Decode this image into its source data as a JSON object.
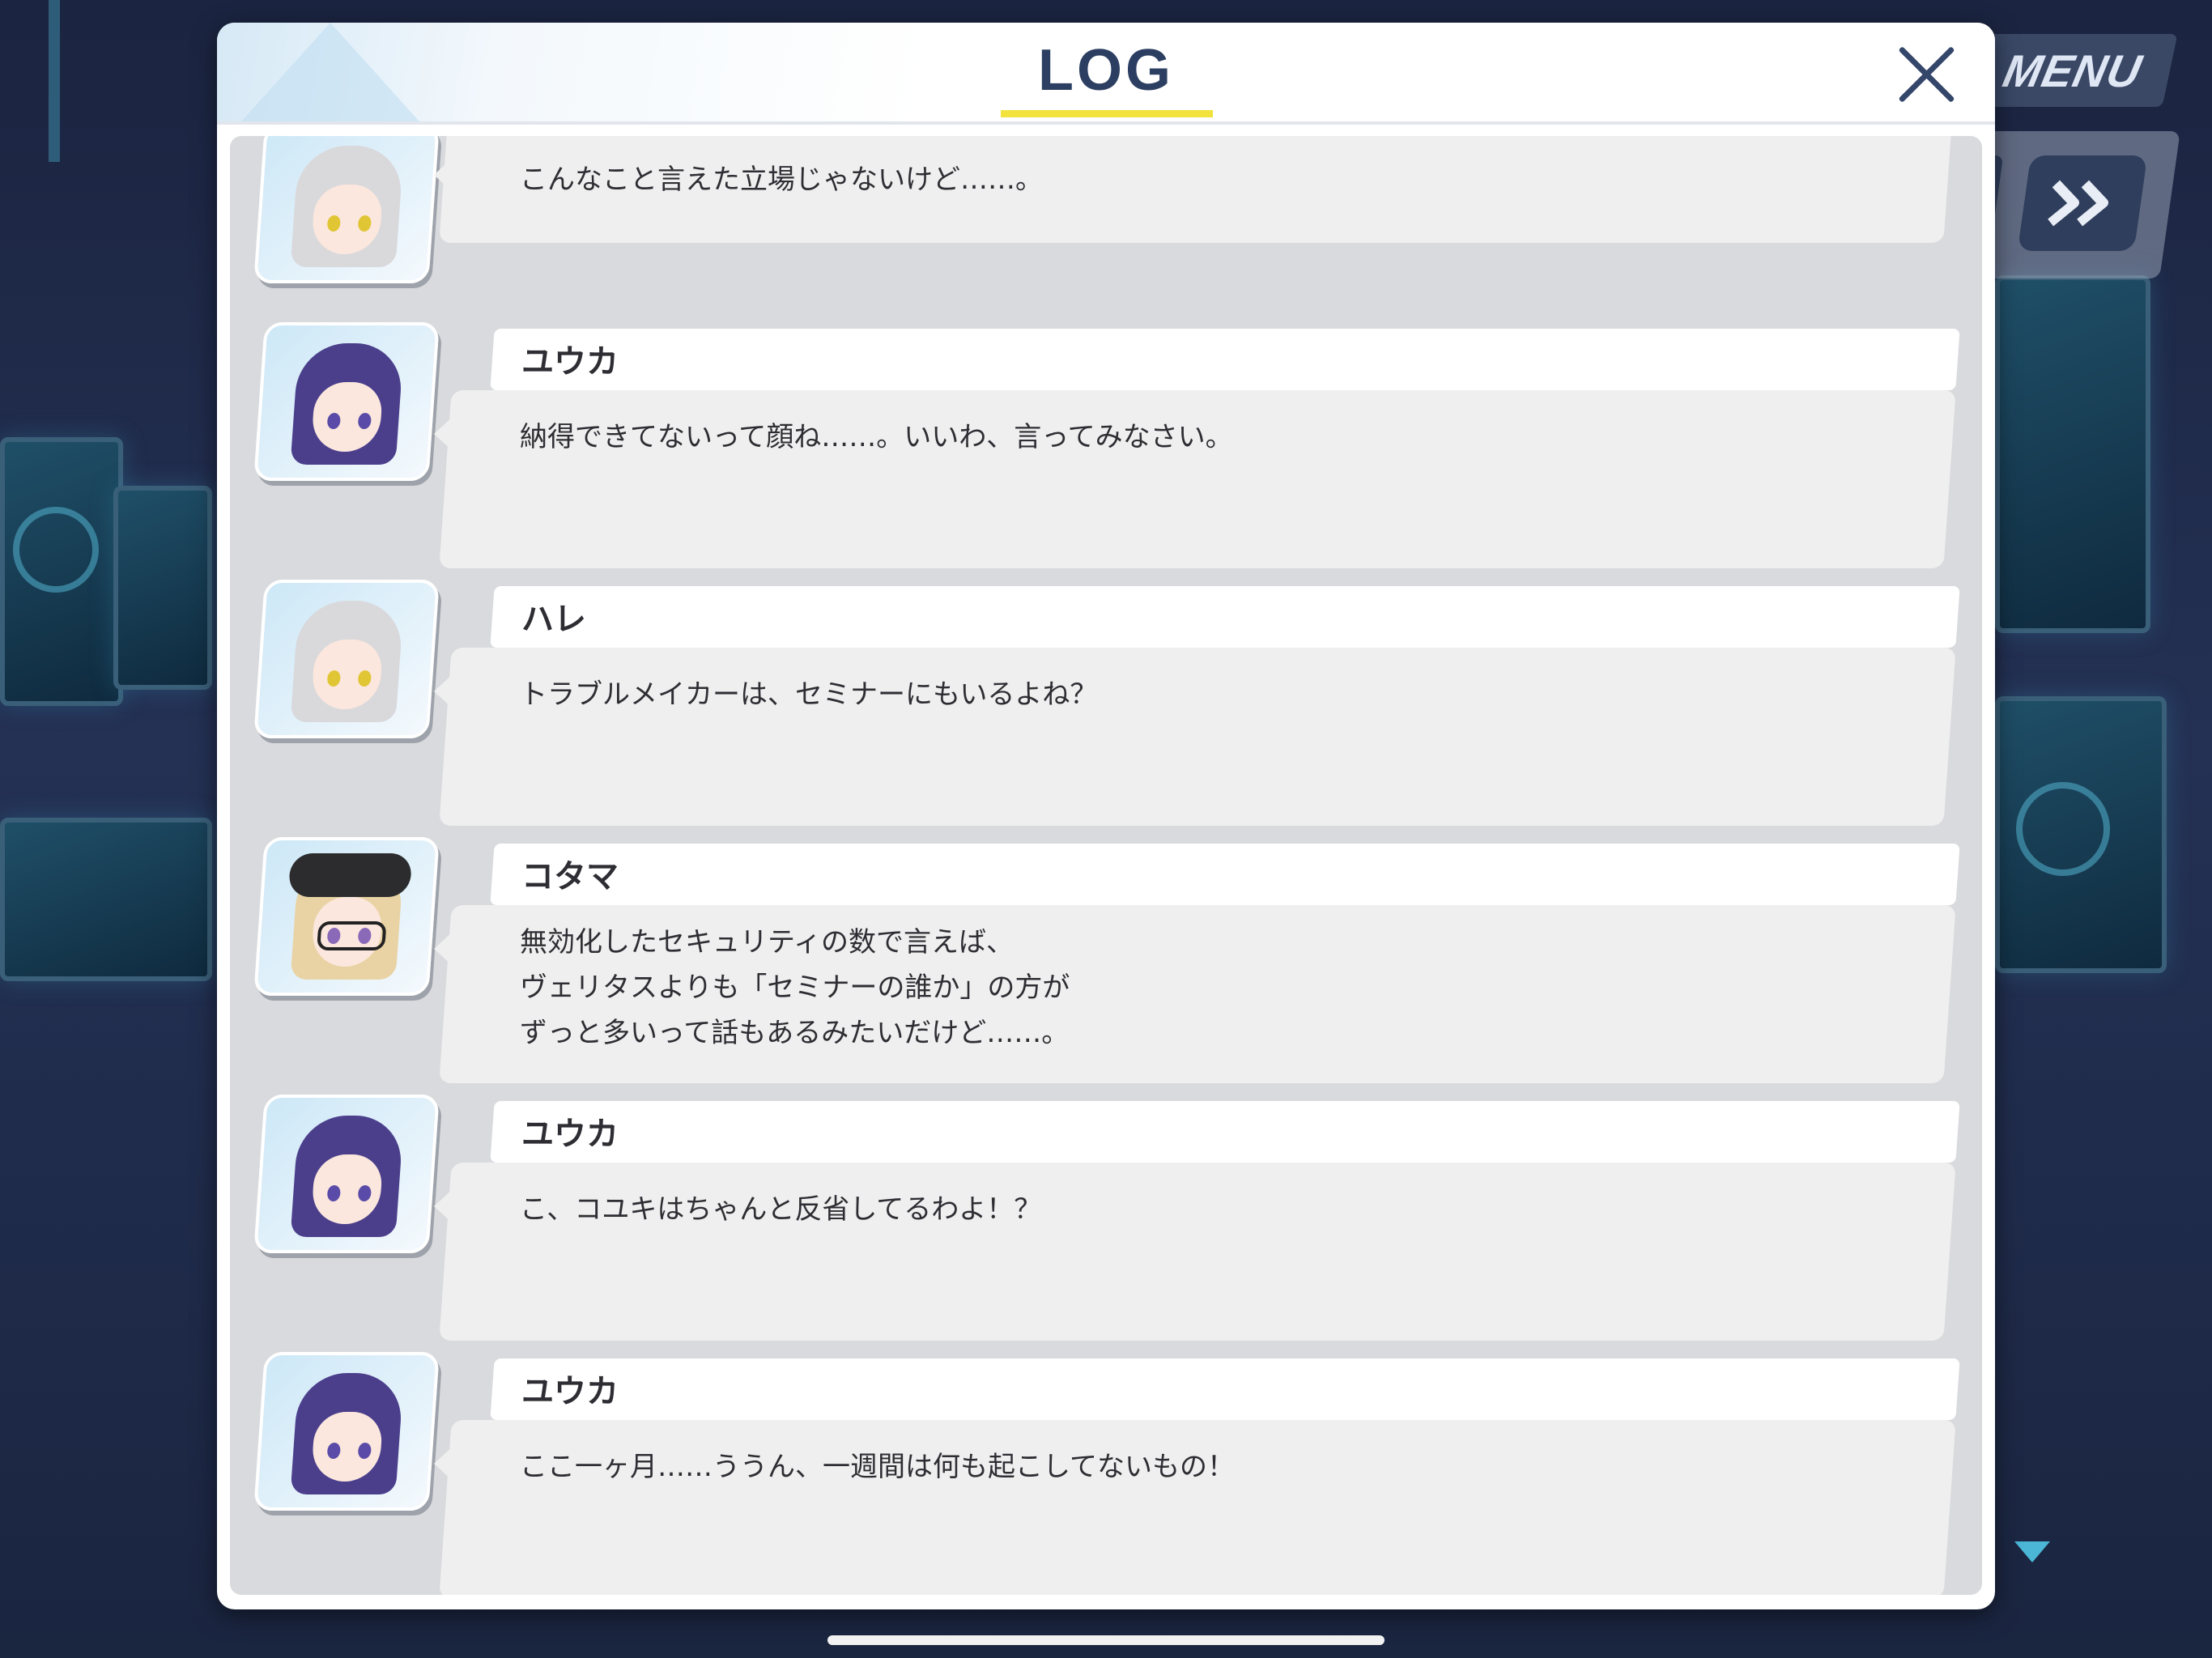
{
  "header": {
    "title": "LOG",
    "close_icon": "close-icon"
  },
  "menu": {
    "label": "MENU"
  },
  "skip": {
    "icon": "double-chevron-right-icon"
  },
  "entries": [
    {
      "speaker": "",
      "character": "hare",
      "text": "こんなこと言えた立場じゃないけど……。"
    },
    {
      "speaker": "ユウカ",
      "character": "yuuka",
      "text": "納得できてないって顔ね……。いいわ、言ってみなさい。"
    },
    {
      "speaker": "ハレ",
      "character": "hare",
      "text": "トラブルメイカーは、セミナーにもいるよね？"
    },
    {
      "speaker": "コタマ",
      "character": "kotama",
      "text": "無効化したセキュリティの数で言えば、\nヴェリタスよりも「セミナーの誰か」の方が\nずっと多いって話もあるみたいだけど……。"
    },
    {
      "speaker": "ユウカ",
      "character": "yuuka",
      "text": "こ、コユキはちゃんと反省してるわよ！？"
    },
    {
      "speaker": "ユウカ",
      "character": "yuuka",
      "text": "ここ一ヶ月……ううん、一週間は何も起こしてないもの！"
    }
  ],
  "colors": {
    "title_underline": "#f2e23c",
    "header_text": "#2c3f62",
    "bubble": "#efefef",
    "log_bg": "#d9dadd"
  }
}
